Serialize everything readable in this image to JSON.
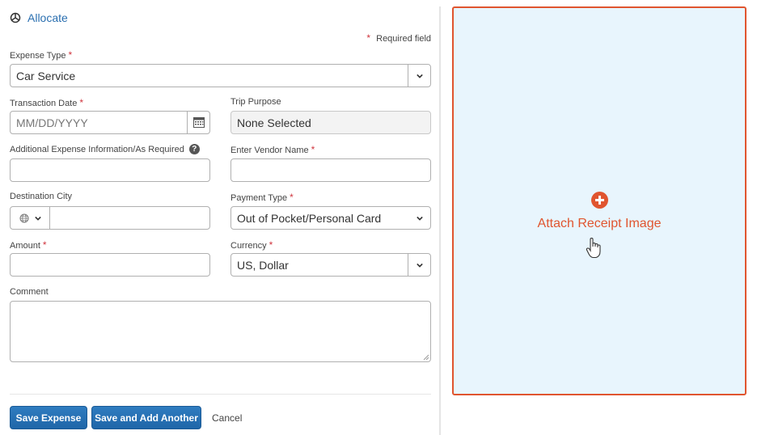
{
  "allocate": {
    "label": "Allocate",
    "icon": "pie-chart-icon"
  },
  "required_note": {
    "asterisk": "*",
    "text": "Required field"
  },
  "form": {
    "expense_type": {
      "label": "Expense Type",
      "required": "*",
      "value": "Car Service"
    },
    "transaction_date": {
      "label": "Transaction Date",
      "required": "*",
      "placeholder": "MM/DD/YYYY"
    },
    "trip_purpose": {
      "label": "Trip Purpose",
      "value": "None Selected"
    },
    "additional_info": {
      "label": "Additional Expense Information/As Required",
      "value": ""
    },
    "vendor_name": {
      "label": "Enter Vendor Name",
      "required": "*",
      "value": ""
    },
    "destination_city": {
      "label": "Destination City",
      "value": ""
    },
    "payment_type": {
      "label": "Payment Type",
      "required": "*",
      "value": "Out of Pocket/Personal Card"
    },
    "amount": {
      "label": "Amount",
      "required": "*",
      "value": ""
    },
    "currency": {
      "label": "Currency",
      "required": "*",
      "value": "US, Dollar"
    },
    "comment": {
      "label": "Comment",
      "value": ""
    }
  },
  "buttons": {
    "save_expense": "Save Expense",
    "save_add_another": "Save and Add Another",
    "cancel": "Cancel"
  },
  "receipt": {
    "label": "Attach Receipt Image"
  },
  "colors": {
    "accent_blue": "#1f66a8",
    "link_blue": "#2a6fb0",
    "receipt_orange": "#e0552f",
    "receipt_bg": "#e8f5fd",
    "required_red": "#d0353e"
  }
}
